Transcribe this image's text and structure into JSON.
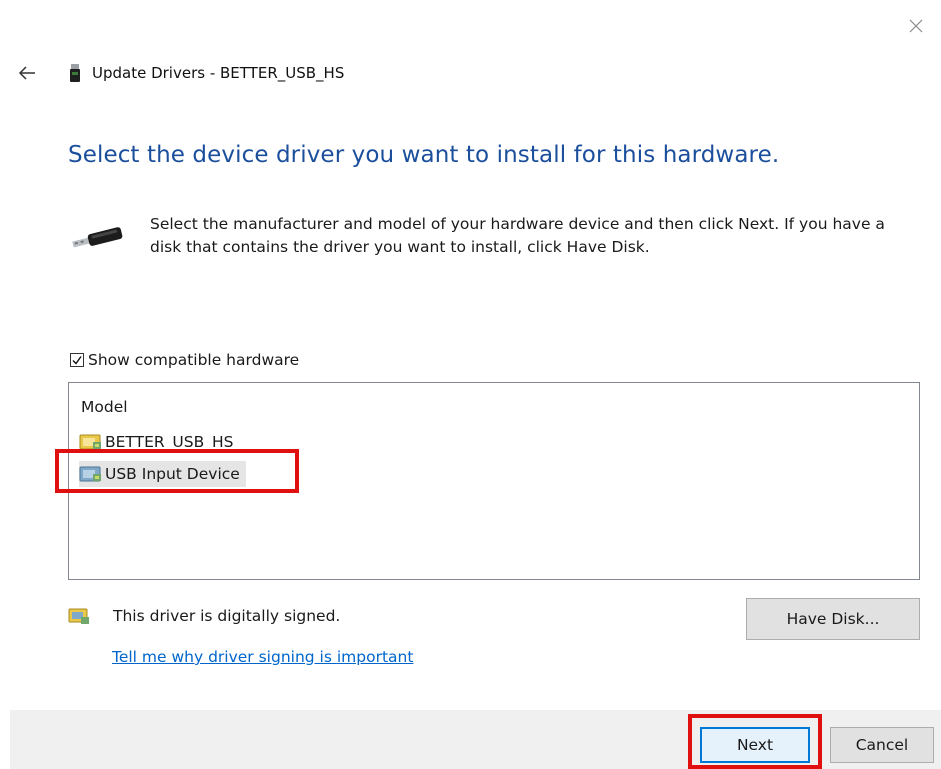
{
  "window": {
    "title": "Update Drivers - BETTER_USB_HS"
  },
  "heading": "Select the device driver you want to install for this hardware.",
  "instruction": "Select the manufacturer and model of your hardware device and then click Next. If you have a disk that contains the driver you want to install, click Have Disk.",
  "compatible_hardware": {
    "label": "Show compatible hardware",
    "checked": true
  },
  "model_list": {
    "header": "Model",
    "items": [
      {
        "label": "BETTER_USB_HS",
        "selected": false
      },
      {
        "label": "USB Input Device",
        "selected": true
      }
    ]
  },
  "signing": {
    "status_text": "This driver is digitally signed.",
    "link_text": "Tell me why driver signing is important"
  },
  "buttons": {
    "have_disk": "Have Disk...",
    "next": "Next",
    "cancel": "Cancel"
  },
  "colors": {
    "heading": "#1b4f9c",
    "link": "#0066cc",
    "highlight": "#e01010",
    "focus_border": "#0078d7"
  },
  "icons": {
    "close": "close-icon",
    "back": "back-arrow-icon",
    "device": "usb-device-icon",
    "driver": "driver-package-icon",
    "signed": "signed-driver-icon"
  }
}
